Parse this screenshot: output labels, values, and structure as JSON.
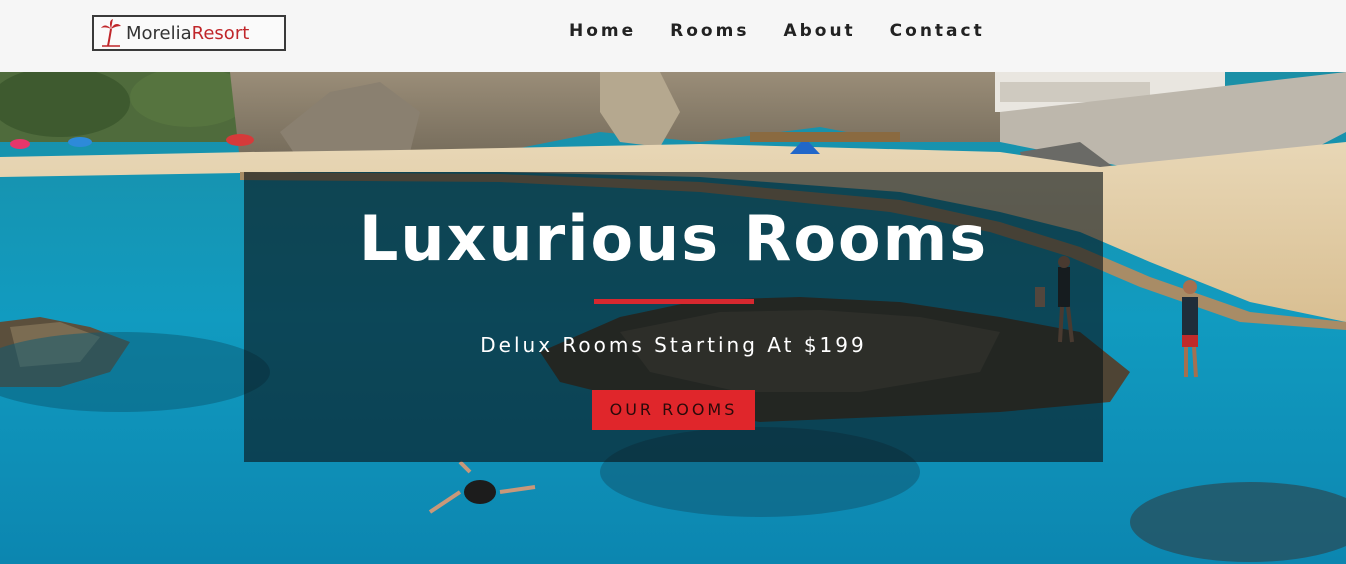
{
  "header": {
    "logo": {
      "word1": "Morelia",
      "word2": "Resort"
    },
    "nav": [
      {
        "label": "Home"
      },
      {
        "label": "Rooms"
      },
      {
        "label": "About"
      },
      {
        "label": "Contact"
      }
    ]
  },
  "hero": {
    "title": "Luxurious Rooms",
    "subtitle": "Delux Rooms Starting At $199",
    "button_label": "OUR ROOMS"
  },
  "colors": {
    "accent": "#e0262b",
    "header_bg": "#f6f6f6",
    "overlay_bg": "rgba(10,20,25,0.62)"
  }
}
